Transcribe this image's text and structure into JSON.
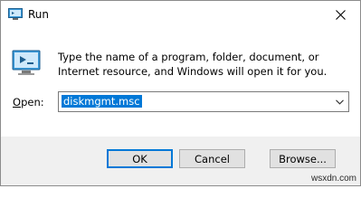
{
  "window": {
    "title": "Run",
    "close_icon": "close-icon"
  },
  "description": "Type the name of a program, folder, document, or Internet resource, and Windows will open it for you.",
  "open": {
    "label_prefix": "O",
    "label_suffix": "pen:",
    "value": "diskmgmt.msc"
  },
  "buttons": {
    "ok": "OK",
    "cancel": "Cancel",
    "browse": "Browse..."
  },
  "watermark": "wsxdn.com",
  "colors": {
    "accent": "#0078d7",
    "footer": "#f0f0f0",
    "button": "#e1e1e1"
  }
}
